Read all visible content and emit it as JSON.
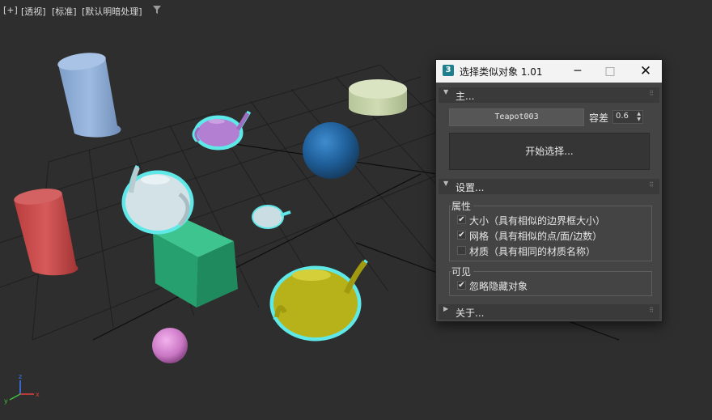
{
  "viewport": {
    "labels": [
      "[+]",
      "[透视]",
      "[标准]",
      "[默认明暗处理]"
    ],
    "filter_icon": "funnel-icon",
    "axis_labels": {
      "x": "x",
      "y": "y",
      "z": "z"
    }
  },
  "dialog": {
    "app_icon_text": "3",
    "title": "选择类似对象 1.01",
    "controls": {
      "minimize": "─",
      "maximize": "□",
      "close": "✕"
    },
    "rollout_main": {
      "title": "主...",
      "object_name": "Teapot003",
      "tolerance_label": "容差",
      "tolerance_value": "0.6",
      "start_button": "开始选择..."
    },
    "rollout_settings": {
      "title": "设置...",
      "group_properties": {
        "label": "属性",
        "items": [
          {
            "label": "大小（具有相似的边界框大小）",
            "checked": true
          },
          {
            "label": "网格（具有相似的点/面/边数）",
            "checked": true
          },
          {
            "label": "材质（具有相同的材质名称）",
            "checked": false
          }
        ]
      },
      "group_visible": {
        "label": "可见",
        "items": [
          {
            "label": "忽略隐藏对象",
            "checked": true
          }
        ]
      }
    },
    "rollout_about": {
      "title": "关于..."
    }
  },
  "colors": {
    "viewport_bg": "#2e2e2e",
    "grid": "#1f1f1f",
    "selection_outline": "#5fe8e8",
    "dialog_bg": "#444444",
    "titlebar_bg": "#f3f3f3"
  }
}
